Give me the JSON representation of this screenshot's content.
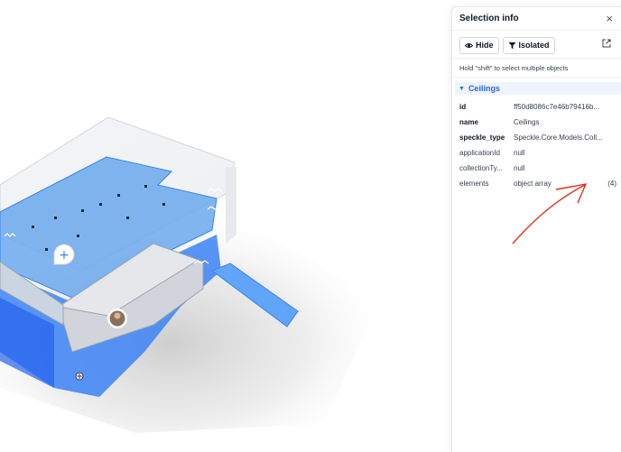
{
  "panel": {
    "title": "Selection info",
    "hide_label": "Hide",
    "isolated_label": "Isolated",
    "hint": "Hold \"shift\" to select multiple objects",
    "section_title": "Ceilings",
    "properties": [
      {
        "key": "id",
        "value": "ff50d8086c7e46b79416b..."
      },
      {
        "key": "name",
        "value": "Ceilings"
      },
      {
        "key": "speckle_type",
        "value": "Speckle.Core.Models.Coll..."
      },
      {
        "key": "applicationId",
        "value": "null"
      },
      {
        "key": "collectionTy...",
        "value": "null"
      },
      {
        "key": "elements",
        "value": "object array",
        "count": "(4)"
      }
    ]
  },
  "viewer": {
    "add_comment_icon": "plus-icon",
    "accent_color": "#3b82f6",
    "annotation_color": "#e0301e"
  }
}
